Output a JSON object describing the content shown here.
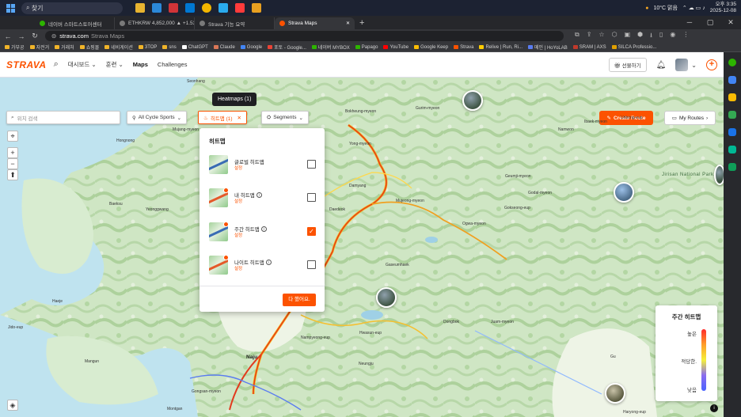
{
  "taskbar": {
    "search_placeholder": "찾기",
    "weather": "10°C 맑음",
    "time": "오후 3:35",
    "date": "2025-12-08"
  },
  "browser": {
    "tabs": [
      {
        "label": "네이버 스마트스토어센터",
        "color": "#2db400"
      },
      {
        "label": "ETHKRW 4,852,000 ▲ +1.53%",
        "color": "#7a7a7a"
      },
      {
        "label": "Strava 기능 요약",
        "color": "#7a7a7a"
      },
      {
        "label": "Strava Maps",
        "color": "#fc5200",
        "active": true
      }
    ],
    "url_host": "strava.com",
    "url_title": "Strava Maps",
    "bookmarks": [
      {
        "label": "가부공",
        "color": "#f0b429"
      },
      {
        "label": "자전거",
        "color": "#f0b429"
      },
      {
        "label": "거래처",
        "color": "#f0b429"
      },
      {
        "label": "쇼핑몰",
        "color": "#f0b429"
      },
      {
        "label": "네비게이션",
        "color": "#f0b429"
      },
      {
        "label": "3TOP",
        "color": "#f0b429"
      },
      {
        "label": "sns",
        "color": "#f0b429"
      },
      {
        "label": "ChatGPT",
        "color": "#ffffff"
      },
      {
        "label": "Claude",
        "color": "#d97757"
      },
      {
        "label": "Google",
        "color": "#4285f4"
      },
      {
        "label": "포토 - Google...",
        "color": "#ea4335"
      },
      {
        "label": "네이버 MYBOX",
        "color": "#2db400"
      },
      {
        "label": "Papago",
        "color": "#2db400"
      },
      {
        "label": "YouTube",
        "color": "#ff0000"
      },
      {
        "label": "Google Keep",
        "color": "#fbbc04"
      },
      {
        "label": "Strava",
        "color": "#fc5200"
      },
      {
        "label": "Relive | Run, Ri...",
        "color": "#ffcc00"
      },
      {
        "label": "메인 | HoYoLAB",
        "color": "#5a7cf0"
      },
      {
        "label": "SRAM | AXS",
        "color": "#c0392b"
      },
      {
        "label": "SILCA Professio...",
        "color": "#e0a000"
      }
    ]
  },
  "strava": {
    "logo": "STRAVA",
    "nav": {
      "dashboard": "대시보드",
      "training": "훈련",
      "maps": "Maps",
      "challenges": "Challenges",
      "gift": "선물하기"
    },
    "tooltip": "Heatmaps (1)",
    "search_placeholder": "위치 검색",
    "sport_filter": "All Cycle Sports",
    "heatmap_chip": "히트맵 (1)",
    "segments_chip": "Segments",
    "create_route": "Create Route",
    "my_routes": "My Routes",
    "panel": {
      "title": "히트맵",
      "items": [
        {
          "name": "글로벌 히트맵",
          "setting": "설정",
          "checked": false
        },
        {
          "name": "내 히트맵",
          "setting": "설정",
          "checked": false
        },
        {
          "name": "주간 히트맵",
          "setting": "설정",
          "checked": true
        },
        {
          "name": "나이트 히트맵",
          "setting": "설정",
          "checked": false
        }
      ],
      "done": "다 했어요."
    },
    "legend": {
      "title": "주간 히트맵",
      "high": "높은",
      "mid": "적당한.",
      "low": "낮음"
    },
    "map_controls": {
      "three_d": "3D"
    },
    "map_labels": [
      "Seonhang",
      "Hongnong",
      "Mujang-myeon",
      "Baeksu",
      "Yeonggwang",
      "Gurim-myeon",
      "Bokheung-myeon",
      "Yong-myeon",
      "Damyang",
      "Mujeong-myeon",
      "Daedeok",
      "Gaseumhaek",
      "Namwon",
      "Ibaek-myeon",
      "Unbong-eup",
      "Geumji-myeon",
      "Godal-myeon",
      "Gokseong-eup",
      "Ogwa-myeon",
      "Jirisan National Park",
      "Haeje",
      "Jido-eup",
      "Mangun",
      "Naju",
      "Nampyeong-eup",
      "Hwasun-eup",
      "Dongbok",
      "Juam-myeon",
      "Neungju",
      "Gongsan-myeon",
      "Montgan",
      "Gu",
      "Haryong-eup",
      "Gwangju"
    ],
    "scale": "5km"
  }
}
